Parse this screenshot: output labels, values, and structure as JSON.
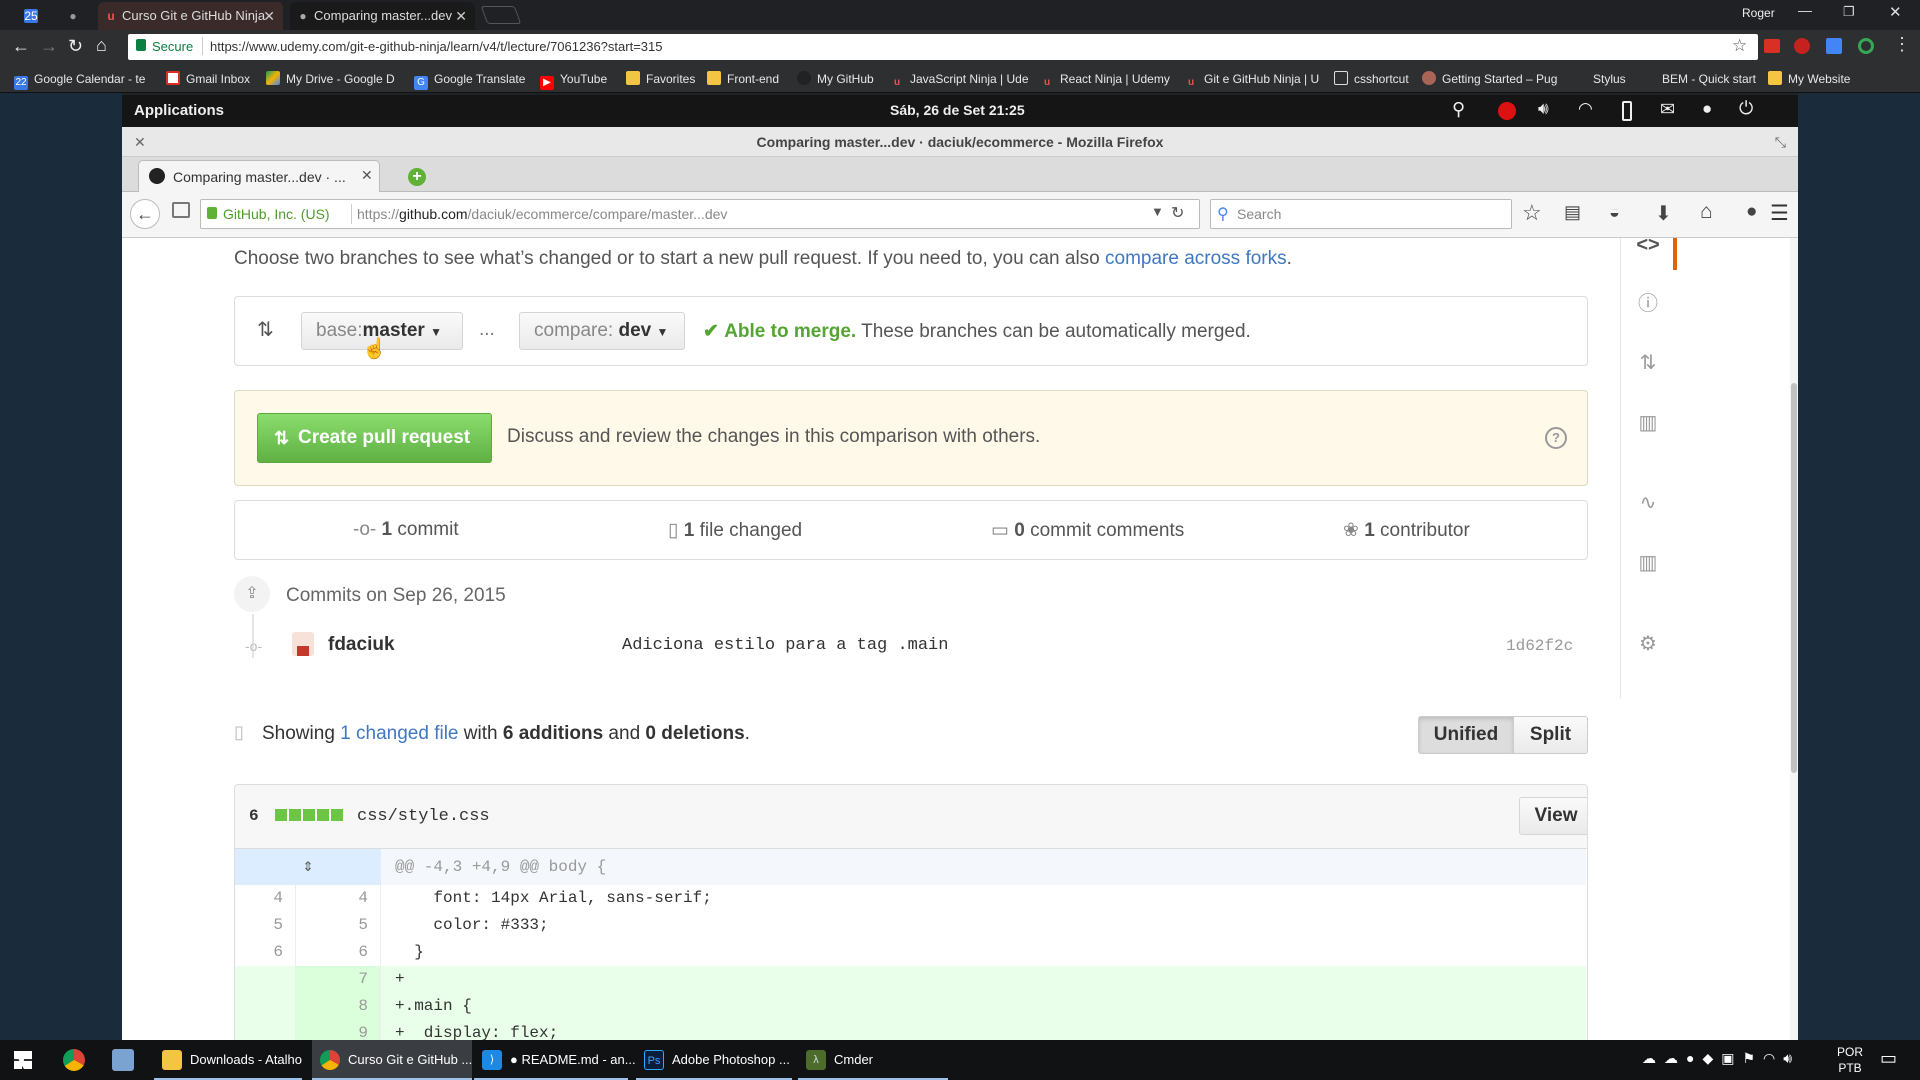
{
  "chrome": {
    "tabs": [
      {
        "label": "Curso Git e GitHub Ninja"
      },
      {
        "label": "Comparing master...dev"
      }
    ],
    "user": "Roger",
    "secure": "Secure",
    "url": "https://www.udemy.com/git-e-github-ninja/learn/v4/t/lecture/7061236?start=315",
    "bookmarks": [
      "Google Calendar - te",
      "Gmail Inbox",
      "My Drive - Google D",
      "Google Translate",
      "YouTube",
      "Favorites",
      "Front-end",
      "My GitHub",
      "JavaScript Ninja | Ude",
      "React Ninja | Udemy",
      "Git e GitHub Ninja | U",
      "csshortcut",
      "Getting Started – Pug",
      "Stylus",
      "BEM - Quick start",
      "My Website"
    ],
    "calendar_day": "25"
  },
  "vm": {
    "applications": "Applications",
    "datetime": "Sáb, 26 de Set 21:25"
  },
  "firefox": {
    "window_title": "Comparing master...dev · daciuk/ecommerce - Mozilla Firefox",
    "tab_label": "Comparing master...dev · ...",
    "identity": "GitHub, Inc. (US)",
    "url_prefix": "https://",
    "url_host": "github.com",
    "url_path": "/daciuk/ecommerce/compare/master...dev",
    "search_placeholder": "Search"
  },
  "github": {
    "intro": "Choose two branches to see what’s changed or to start a new pull request. If you need to, you can also ",
    "intro_link": "compare across forks",
    "intro_end": ".",
    "base_label": "base:",
    "base_value": "master",
    "dots": "...",
    "compare_label": "compare:",
    "compare_value": "dev",
    "merge_ok": "Able to merge.",
    "merge_text": " These branches can be automatically merged.",
    "create_pr": "Create pull request",
    "pr_desc": "Discuss and review the changes in this comparison with others.",
    "stats": [
      {
        "num": "1",
        "label": " commit"
      },
      {
        "num": "1",
        "label": " file changed"
      },
      {
        "num": "0",
        "label": " commit comments"
      },
      {
        "num": "1",
        "label": " contributor"
      }
    ],
    "commits_header": "Commits on Sep 26, 2015",
    "commit": {
      "author": "fdaciuk",
      "message": "Adiciona estilo para a tag .main",
      "sha": "1d62f2c"
    },
    "showing": "Showing ",
    "changed_link": "1 changed file",
    "with": " with ",
    "additions": "6 additions",
    "and": " and ",
    "deletions": "0 deletions",
    "period": ".",
    "view_unified": "Unified",
    "view_split": "Split",
    "file": {
      "count": "6",
      "path": "css/style.css",
      "view": "View"
    },
    "hunk": "@@ -4,3 +4,9 @@ body {",
    "diff": [
      {
        "old": "4",
        "new": "4",
        "code": "    font: 14px Arial, sans-serif;",
        "add": false
      },
      {
        "old": "5",
        "new": "5",
        "code": "    color: #333;",
        "add": false
      },
      {
        "old": "6",
        "new": "6",
        "code": "  }",
        "add": false
      },
      {
        "old": "",
        "new": "7",
        "code": "+",
        "add": true
      },
      {
        "old": "",
        "new": "8",
        "code": "+.main {",
        "add": true
      },
      {
        "old": "",
        "new": "9",
        "code": "+  display: flex;",
        "add": true
      }
    ]
  },
  "taskbar": {
    "items": [
      "Downloads - Atalho",
      "Curso Git e GitHub ...",
      "● README.md - an...",
      "Adobe Photoshop ...",
      "Cmder"
    ],
    "lang1": "POR",
    "lang2": "PTB"
  }
}
